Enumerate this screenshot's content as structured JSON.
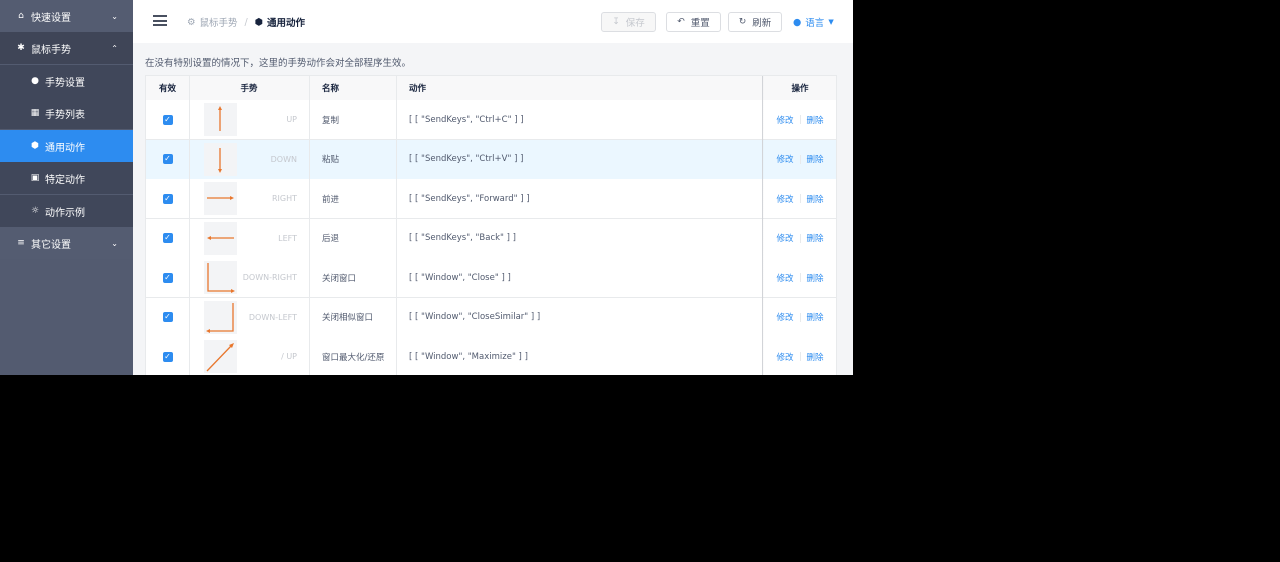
{
  "sidebar": {
    "items": [
      {
        "label": "快速设置",
        "icon": "home-icon"
      },
      {
        "label": "鼠标手势",
        "icon": "gear-icon"
      },
      {
        "label": "手势设置",
        "icon": "palette-icon"
      },
      {
        "label": "手势列表",
        "icon": "grid-icon"
      },
      {
        "label": "通用动作",
        "icon": "cube-icon"
      },
      {
        "label": "特定动作",
        "icon": "lock-icon"
      },
      {
        "label": "动作示例",
        "icon": "bulb-icon"
      },
      {
        "label": "其它设置",
        "icon": "sliders-icon"
      }
    ]
  },
  "header": {
    "breadcrumb_parent": "鼠标手势",
    "breadcrumb_current": "通用动作",
    "save_label": "保存",
    "reset_label": "重置",
    "refresh_label": "刷新",
    "language_label": "语言"
  },
  "description": "在没有特别设置的情况下，这里的手势动作会对全部程序生效。",
  "table": {
    "columns": {
      "enabled": "有效",
      "gesture": "手势",
      "name": "名称",
      "action": "动作",
      "ops": "操作"
    },
    "edit_label": "修改",
    "delete_label": "删除",
    "rows": [
      {
        "gesture": "UP",
        "name": "复制",
        "action": "[ [ \"SendKeys\", \"Ctrl+C\" ] ]",
        "enabled": true
      },
      {
        "gesture": "DOWN",
        "name": "粘贴",
        "action": "[ [ \"SendKeys\", \"Ctrl+V\" ] ]",
        "enabled": true
      },
      {
        "gesture": "RIGHT",
        "name": "前进",
        "action": "[ [ \"SendKeys\", \"Forward\" ] ]",
        "enabled": true
      },
      {
        "gesture": "LEFT",
        "name": "后退",
        "action": "[ [ \"SendKeys\", \"Back\" ] ]",
        "enabled": true
      },
      {
        "gesture": "DOWN-RIGHT",
        "name": "关闭窗口",
        "action": "[ [ \"Window\", \"Close\" ] ]",
        "enabled": true
      },
      {
        "gesture": "DOWN-LEFT",
        "name": "关闭相似窗口",
        "action": "[ [ \"Window\", \"CloseSimilar\" ] ]",
        "enabled": true
      },
      {
        "gesture": "/ UP",
        "name": "窗口最大化/还原",
        "action": "[ [ \"Window\", \"Maximize\" ] ]",
        "enabled": true
      }
    ]
  },
  "colors": {
    "accent": "#2d8cf0",
    "sidebar": "#535b70",
    "gesture_stroke": "#e8772e"
  }
}
